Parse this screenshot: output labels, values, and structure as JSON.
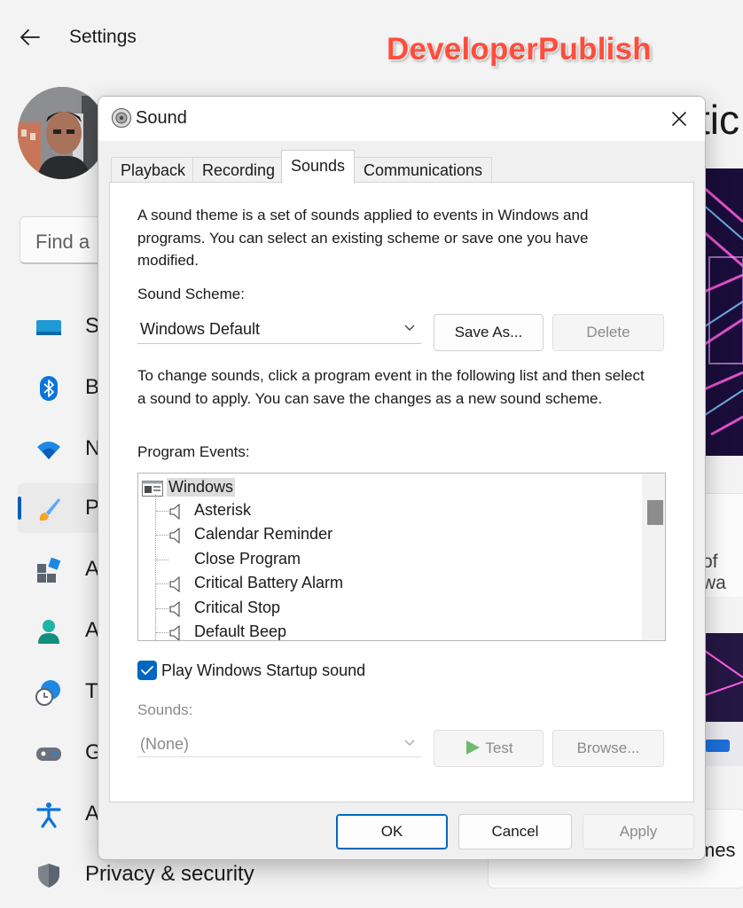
{
  "background": {
    "window_title": "Settings",
    "watermark": "DeveloperPublish",
    "search_placeholder": "Find a",
    "nav": [
      {
        "label": "Sy",
        "icon": "system-icon"
      },
      {
        "label": "B",
        "icon": "bluetooth-icon"
      },
      {
        "label": "N",
        "icon": "network-icon"
      },
      {
        "label": "P",
        "icon": "personalization-brush-icon",
        "active": true
      },
      {
        "label": "A",
        "icon": "apps-icon"
      },
      {
        "label": "A",
        "icon": "accounts-icon"
      },
      {
        "label": "T",
        "icon": "time-language-icon"
      },
      {
        "label": "G",
        "icon": "gaming-icon"
      },
      {
        "label": "A",
        "icon": "accessibility-icon"
      },
      {
        "label": "Privacy & security",
        "icon": "shield-icon"
      }
    ],
    "right_title": "tic",
    "right_panel_text": "of wa",
    "right_panel3_text": "mes"
  },
  "dialog": {
    "title": "Sound",
    "tabs": [
      "Playback",
      "Recording",
      "Sounds",
      "Communications"
    ],
    "selected_tab": "Sounds",
    "intro_text": "A sound theme is a set of sounds applied to events in Windows and programs.  You can select an existing scheme or save one you have modified.",
    "scheme_label": "Sound Scheme:",
    "scheme_value": "Windows Default",
    "save_as_label": "Save As...",
    "delete_label": "Delete",
    "change_text": "To change sounds, click a program event in the following list and then select a sound to apply.  You can save the changes as a new sound scheme.",
    "events_label": "Program Events:",
    "events_root": "Windows",
    "events": [
      {
        "label": "Asterisk",
        "has_sound": true
      },
      {
        "label": "Calendar Reminder",
        "has_sound": true
      },
      {
        "label": "Close Program",
        "has_sound": false
      },
      {
        "label": "Critical Battery Alarm",
        "has_sound": true
      },
      {
        "label": "Critical Stop",
        "has_sound": true
      },
      {
        "label": "Default Beep",
        "has_sound": true
      }
    ],
    "startup_sound_label": "Play Windows Startup sound",
    "startup_sound_checked": true,
    "sounds_label": "Sounds:",
    "sounds_value": "(None)",
    "test_label": "Test",
    "browse_label": "Browse...",
    "ok_label": "OK",
    "cancel_label": "Cancel",
    "apply_label": "Apply"
  },
  "colors": {
    "accent": "#0067c0",
    "watermark": "#ff4d3d",
    "test_play": "#6dbb6d"
  }
}
